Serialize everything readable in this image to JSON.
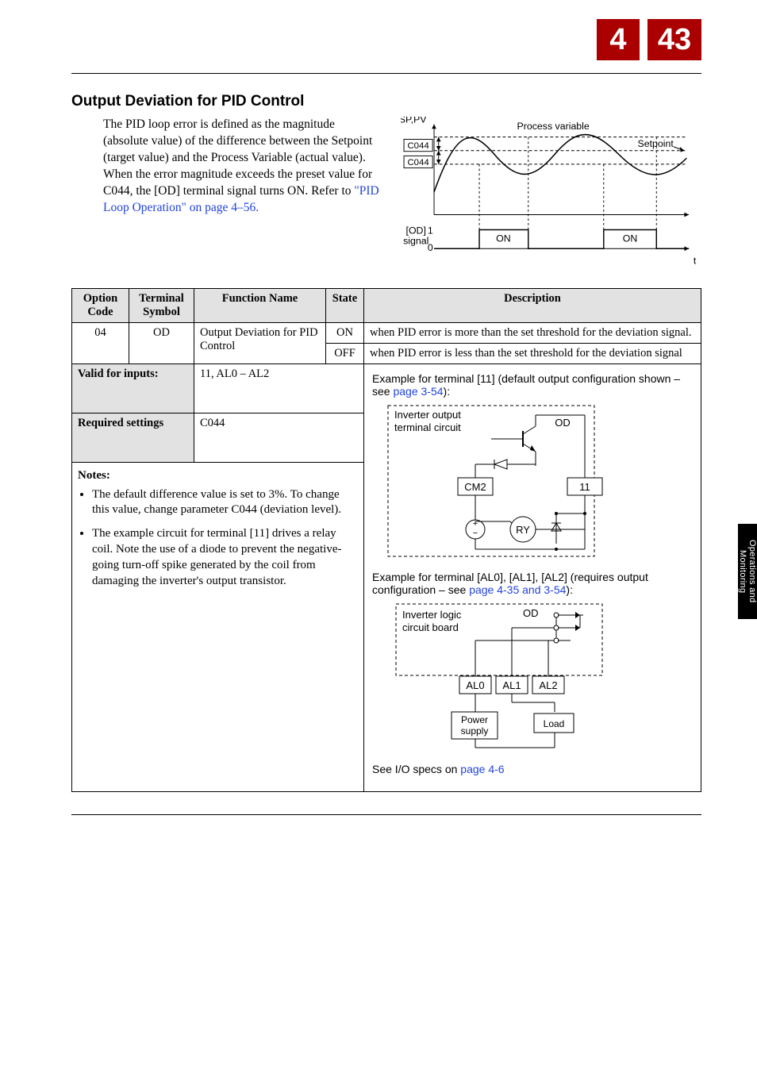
{
  "header": {
    "chapter": "4",
    "page": "43"
  },
  "main": {
    "section_title": "Output Deviation for PID Control",
    "body_paragraph_a": "The PID loop error is defined as the magnitude (absolute value) of the difference between the Setpoint (target value) and the Process Variable (actual value). When the error magnitude exceeds the preset value for C044, the [OD] terminal signal turns ON. Refer to ",
    "body_link": "\"PID Loop Operation\" on page 4–56.",
    "diagram1": {
      "y_label": "SP,PV",
      "pv_label": "Process variable",
      "sp_label": "Setpoint",
      "band_top": "C044",
      "band_bot": "C044",
      "od_label": "[OD]\nsignal",
      "one": "1",
      "zero": "0",
      "on1": "ON",
      "on2": "ON",
      "t": "t"
    }
  },
  "table": {
    "headers": {
      "opt": "Option\nCode",
      "term": "Terminal\nSymbol",
      "func": "Function Name",
      "state": "State",
      "desc": "Description"
    },
    "row1": {
      "opt": "04",
      "term": "OD",
      "func": "Output Deviation for PID Control",
      "state_on": "ON",
      "desc_on": "when PID error is more than the set threshold for the deviation signal.",
      "state_off": "OFF",
      "desc_off": "when PID error is less than the set threshold for the deviation signal"
    },
    "valid_label": "Valid for inputs:",
    "valid_val": "11, AL0 – AL2",
    "req_label": "Required settings",
    "req_val": "C044",
    "notes_title": "Notes:",
    "note1": "The default difference value is set to 3%. To change this value, change parameter C044 (deviation level).",
    "note2": "The example circuit for terminal [11] drives a relay coil. Note the use of a diode to prevent the negative-going turn-off spike generated by the coil from damaging the inverter's output transistor.",
    "example1_a": "Example for terminal [11] (default output configuration shown – see ",
    "example1_link": "page 3-54",
    "example1_b": "):",
    "circuit1": {
      "inv_label": "Inverter output\nterminal circuit",
      "od": "OD",
      "cm2": "CM2",
      "t11": "11",
      "ry": "RY",
      "plus": "+",
      "minus": "−"
    },
    "example2_a": "Example for terminal [AL0], [AL1], [AL2] (requires output configuration – see ",
    "example2_link": "page 4-35 and 3-54",
    "example2_b": "):",
    "circuit2": {
      "inv_label": "Inverter logic\ncircuit board",
      "od": "OD",
      "al0": "AL0",
      "al1": "AL1",
      "al2": "AL2",
      "power": "Power\nsupply",
      "load": "Load"
    },
    "iospecs_a": "See I/O specs on ",
    "iospecs_link": "page 4-6"
  },
  "side_tab": "Operations and\nMonitoring"
}
